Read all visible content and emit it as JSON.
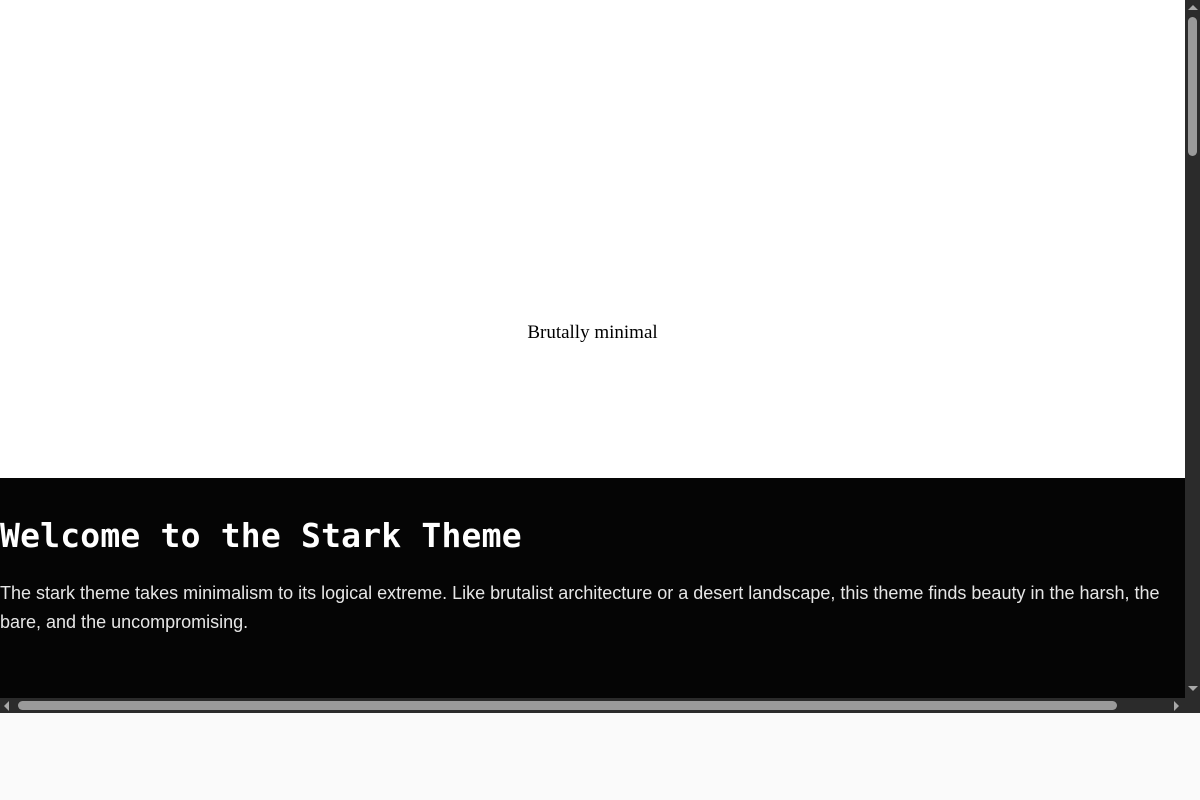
{
  "hero": {
    "caption": "Brutally minimal"
  },
  "section": {
    "heading": "Welcome to the Stark Theme",
    "body": "The stark theme takes minimalism to its logical extreme. Like brutalist architecture or a desert landscape, this theme finds beauty in the harsh, the bare, and the uncompromising."
  },
  "colors": {
    "hero_background": "#ffffff",
    "section_background": "#050505",
    "section_text": "#ffffff",
    "scrollbar_track": "#2b2b2b",
    "scrollbar_thumb": "#9a9a9a"
  },
  "icons": {
    "scroll_up": "triangle-up-icon",
    "scroll_down": "triangle-down-icon",
    "scroll_left": "triangle-left-icon",
    "scroll_right": "triangle-right-icon"
  }
}
